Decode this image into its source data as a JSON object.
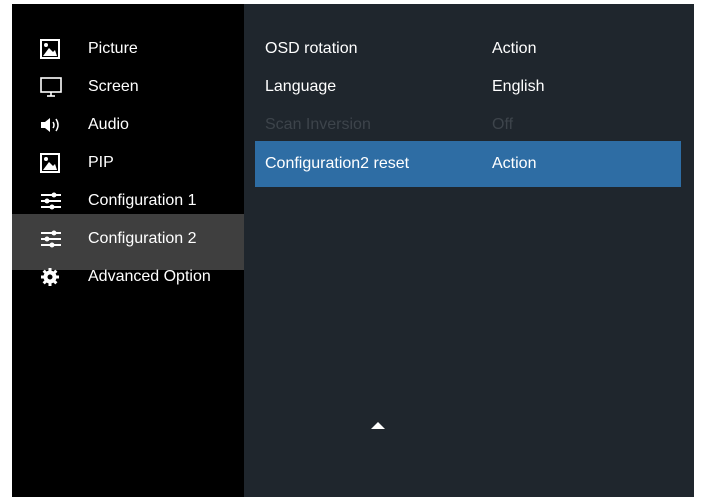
{
  "sidebar": {
    "items": [
      {
        "label": "Picture",
        "icon": "picture-icon"
      },
      {
        "label": "Screen",
        "icon": "monitor-icon"
      },
      {
        "label": "Audio",
        "icon": "speaker-icon"
      },
      {
        "label": "PIP",
        "icon": "picture-icon"
      },
      {
        "label": "Configuration 1",
        "icon": "sliders-icon"
      },
      {
        "label": "Configuration 2",
        "icon": "sliders-icon",
        "selected": true
      },
      {
        "label": "Advanced Option",
        "icon": "gear-icon"
      }
    ]
  },
  "panel": {
    "rows": [
      {
        "name": "OSD rotation",
        "value": "Action"
      },
      {
        "name": "Language",
        "value": "English"
      },
      {
        "name": "Scan Inversion",
        "value": "Off",
        "disabled": true
      },
      {
        "name": "Configuration2 reset",
        "value": "Action",
        "highlighted": true
      }
    ]
  },
  "colors": {
    "sidebar_bg": "#000000",
    "sidebar_selected_bg": "#3f3f3f",
    "panel_bg": "#1f262d",
    "highlight": "#2e6da4",
    "disabled_text": "#3d444b",
    "text": "#ffffff"
  }
}
